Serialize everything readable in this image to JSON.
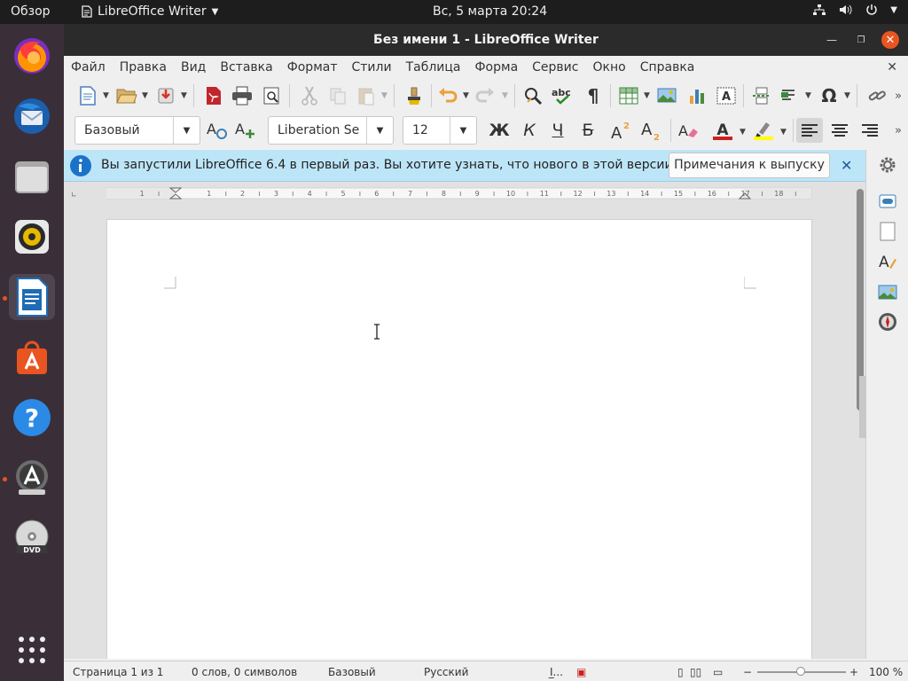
{
  "topbar": {
    "activities": "Обзор",
    "app_name": "LibreOffice Writer",
    "clock": "Вс, 5 марта  20:24"
  },
  "window": {
    "title": "Без имени 1 - LibreOffice Writer"
  },
  "menu": [
    "Файл",
    "Правка",
    "Вид",
    "Вставка",
    "Формат",
    "Стили",
    "Таблица",
    "Форма",
    "Сервис",
    "Окно",
    "Справка"
  ],
  "format_bar": {
    "paragraph_style": "Базовый",
    "font_name": "Liberation Se",
    "font_size": "12",
    "bold_label": "Ж",
    "italic_label": "К",
    "underline_label": "Ч",
    "strike_label": "Б"
  },
  "infobar": {
    "message": "Вы запустили LibreOffice 6.4 в первый раз. Вы хотите узнать, что нового в этой версии?",
    "button_label": "Примечания к выпуску"
  },
  "ruler": {
    "ticks": [
      "1",
      "1",
      "2",
      "3",
      "4",
      "5",
      "6",
      "7",
      "8",
      "9",
      "10",
      "11",
      "12",
      "13",
      "14",
      "15",
      "16",
      "17",
      "18"
    ]
  },
  "statusbar": {
    "page": "Страница 1 из 1",
    "words": "0 слов, 0 символов",
    "style": "Базовый",
    "language": "Русский",
    "zoom": "100 %"
  },
  "colors": {
    "accent": "#e95420",
    "font_color": "#c9211e",
    "highlight": "#ffff00",
    "infobar": "#bde5f8"
  }
}
